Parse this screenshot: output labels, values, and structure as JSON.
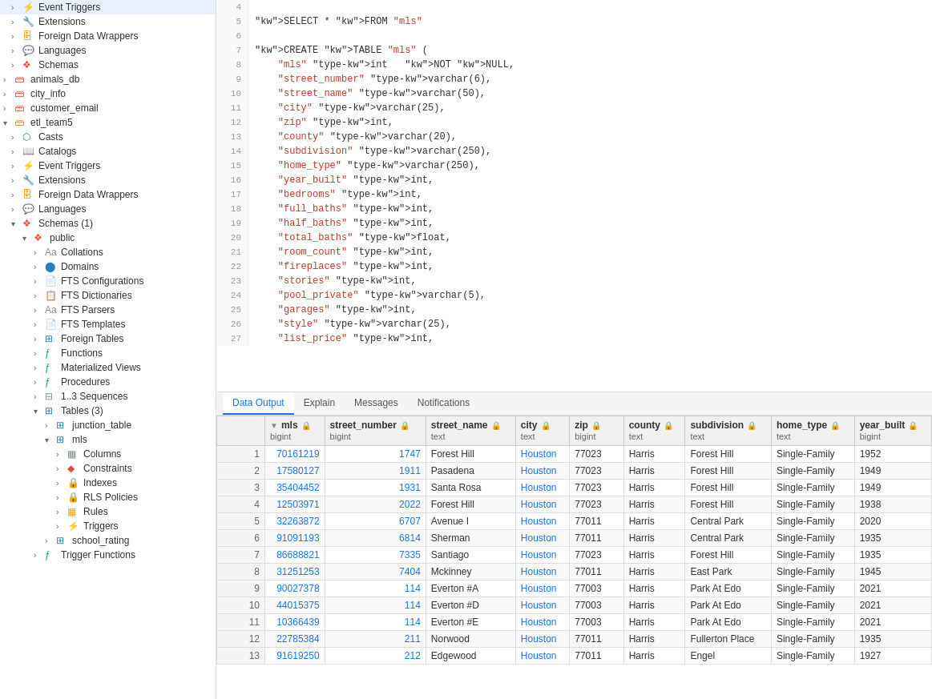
{
  "sidebar": {
    "items": [
      {
        "id": "event-triggers-1",
        "label": "Event Triggers",
        "indent": "indent1",
        "arrow": "›",
        "icon": "⚡",
        "icon_class": "icon-orange"
      },
      {
        "id": "extensions-1",
        "label": "Extensions",
        "indent": "indent1",
        "arrow": "›",
        "icon": "🔧",
        "icon_class": "icon-blue"
      },
      {
        "id": "foreign-data-wrappers-1",
        "label": "Foreign Data Wrappers",
        "indent": "indent1",
        "arrow": "›",
        "icon": "🗄",
        "icon_class": "icon-yellow"
      },
      {
        "id": "languages-1",
        "label": "Languages",
        "indent": "indent1",
        "arrow": "›",
        "icon": "💬",
        "icon_class": "icon-teal"
      },
      {
        "id": "schemas-1",
        "label": "Schemas",
        "indent": "indent1",
        "arrow": "›",
        "icon": "❖",
        "icon_class": "icon-red"
      },
      {
        "id": "animals-db",
        "label": "animals_db",
        "indent": "",
        "arrow": "›",
        "icon": "🗃",
        "icon_class": "icon-red"
      },
      {
        "id": "city-info",
        "label": "city_info",
        "indent": "",
        "arrow": "›",
        "icon": "🗃",
        "icon_class": "icon-red"
      },
      {
        "id": "customer-email",
        "label": "customer_email",
        "indent": "",
        "arrow": "›",
        "icon": "🗃",
        "icon_class": "icon-red"
      },
      {
        "id": "etl-team5",
        "label": "etl_team5",
        "indent": "",
        "arrow": "▾",
        "icon": "🗃",
        "icon_class": "icon-orange"
      },
      {
        "id": "casts",
        "label": "Casts",
        "indent": "indent1",
        "arrow": "›",
        "icon": "⬡",
        "icon_class": "icon-blue"
      },
      {
        "id": "catalogs",
        "label": "Catalogs",
        "indent": "indent1",
        "arrow": "›",
        "icon": "📖",
        "icon_class": "icon-purple"
      },
      {
        "id": "event-triggers-2",
        "label": "Event Triggers",
        "indent": "indent1",
        "arrow": "›",
        "icon": "⚡",
        "icon_class": "icon-orange"
      },
      {
        "id": "extensions-2",
        "label": "Extensions",
        "indent": "indent1",
        "arrow": "›",
        "icon": "🔧",
        "icon_class": "icon-blue"
      },
      {
        "id": "foreign-data-wrappers-2",
        "label": "Foreign Data Wrappers",
        "indent": "indent1",
        "arrow": "›",
        "icon": "🗄",
        "icon_class": "icon-yellow"
      },
      {
        "id": "languages-2",
        "label": "Languages",
        "indent": "indent1",
        "arrow": "›",
        "icon": "💬",
        "icon_class": "icon-teal"
      },
      {
        "id": "schemas-2",
        "label": "Schemas (1)",
        "indent": "indent1",
        "arrow": "▾",
        "icon": "❖",
        "icon_class": "icon-red"
      },
      {
        "id": "public",
        "label": "public",
        "indent": "indent2",
        "arrow": "▾",
        "icon": "❖",
        "icon_class": "icon-red"
      },
      {
        "id": "collations",
        "label": "Collations",
        "indent": "indent3",
        "arrow": "›",
        "icon": "Aa",
        "icon_class": "icon-gray"
      },
      {
        "id": "domains",
        "label": "Domains",
        "indent": "indent3",
        "arrow": "›",
        "icon": "⬤",
        "icon_class": "icon-blue"
      },
      {
        "id": "fts-configs",
        "label": "FTS Configurations",
        "indent": "indent3",
        "arrow": "›",
        "icon": "📄",
        "icon_class": "icon-gray"
      },
      {
        "id": "fts-dicts",
        "label": "FTS Dictionaries",
        "indent": "indent3",
        "arrow": "›",
        "icon": "📋",
        "icon_class": "icon-gray"
      },
      {
        "id": "fts-parsers",
        "label": "FTS Parsers",
        "indent": "indent3",
        "arrow": "›",
        "icon": "Aa",
        "icon_class": "icon-gray"
      },
      {
        "id": "fts-templates",
        "label": "FTS Templates",
        "indent": "indent3",
        "arrow": "›",
        "icon": "📄",
        "icon_class": "icon-gray"
      },
      {
        "id": "foreign-tables",
        "label": "Foreign Tables",
        "indent": "indent3",
        "arrow": "›",
        "icon": "⊞",
        "icon_class": "icon-blue"
      },
      {
        "id": "functions",
        "label": "Functions",
        "indent": "indent3",
        "arrow": "›",
        "icon": "ƒ",
        "icon_class": "icon-teal"
      },
      {
        "id": "materialized-views",
        "label": "Materialized Views",
        "indent": "indent3",
        "arrow": "›",
        "icon": "ƒ",
        "icon_class": "icon-teal"
      },
      {
        "id": "procedures",
        "label": "Procedures",
        "indent": "indent3",
        "arrow": "›",
        "icon": "ƒ",
        "icon_class": "icon-teal"
      },
      {
        "id": "sequences",
        "label": "1..3 Sequences",
        "indent": "indent3",
        "arrow": "›",
        "icon": "⊟",
        "icon_class": "icon-gray"
      },
      {
        "id": "tables",
        "label": "Tables (3)",
        "indent": "indent3",
        "arrow": "▾",
        "icon": "⊞",
        "icon_class": "icon-blue"
      },
      {
        "id": "junction-table",
        "label": "junction_table",
        "indent": "indent4",
        "arrow": "›",
        "icon": "⊞",
        "icon_class": "icon-blue"
      },
      {
        "id": "mls",
        "label": "mls",
        "indent": "indent4",
        "arrow": "▾",
        "icon": "⊞",
        "icon_class": "icon-blue"
      },
      {
        "id": "columns",
        "label": "Columns",
        "indent": "indent5",
        "arrow": "›",
        "icon": "▦",
        "icon_class": "icon-gray"
      },
      {
        "id": "constraints",
        "label": "Constraints",
        "indent": "indent5",
        "arrow": "›",
        "icon": "◆",
        "icon_class": "icon-red"
      },
      {
        "id": "indexes",
        "label": "Indexes",
        "indent": "indent5",
        "arrow": "›",
        "icon": "🔒",
        "icon_class": "icon-yellow"
      },
      {
        "id": "rls-policies",
        "label": "RLS Policies",
        "indent": "indent5",
        "arrow": "›",
        "icon": "🔒",
        "icon_class": "icon-green"
      },
      {
        "id": "rules",
        "label": "Rules",
        "indent": "indent5",
        "arrow": "›",
        "icon": "▦",
        "icon_class": "icon-yellow"
      },
      {
        "id": "triggers",
        "label": "Triggers",
        "indent": "indent5",
        "arrow": "›",
        "icon": "⚡",
        "icon_class": "icon-blue"
      },
      {
        "id": "school-rating",
        "label": "school_rating",
        "indent": "indent4",
        "arrow": "›",
        "icon": "⊞",
        "icon_class": "icon-blue"
      },
      {
        "id": "trigger-functions",
        "label": "Trigger Functions",
        "indent": "indent3",
        "arrow": "›",
        "icon": "ƒ",
        "icon_class": "icon-teal"
      }
    ]
  },
  "editor": {
    "lines": [
      {
        "num": 4,
        "content": ""
      },
      {
        "num": 5,
        "content": "SELECT * FROM \"mls\""
      },
      {
        "num": 6,
        "content": ""
      },
      {
        "num": 7,
        "content": "CREATE TABLE \"mls\" ("
      },
      {
        "num": 8,
        "content": "    \"mls\" int   NOT NULL,"
      },
      {
        "num": 9,
        "content": "    \"street_number\" varchar(6),"
      },
      {
        "num": 10,
        "content": "    \"street_name\" varchar(50),"
      },
      {
        "num": 11,
        "content": "    \"city\" varchar(25),"
      },
      {
        "num": 12,
        "content": "    \"zip\" int,"
      },
      {
        "num": 13,
        "content": "    \"county\" varchar(20),"
      },
      {
        "num": 14,
        "content": "    \"subdivision\" varchar(250),"
      },
      {
        "num": 15,
        "content": "    \"home_type\" varchar(250),"
      },
      {
        "num": 16,
        "content": "    \"year_built\" int,"
      },
      {
        "num": 17,
        "content": "    \"bedrooms\" int,"
      },
      {
        "num": 18,
        "content": "    \"full_baths\" int,"
      },
      {
        "num": 19,
        "content": "    \"half_baths\" int,"
      },
      {
        "num": 20,
        "content": "    \"total_baths\" float,"
      },
      {
        "num": 21,
        "content": "    \"room_count\" int,"
      },
      {
        "num": 22,
        "content": "    \"fireplaces\" int,"
      },
      {
        "num": 23,
        "content": "    \"stories\" int,"
      },
      {
        "num": 24,
        "content": "    \"pool_private\" varchar(5),"
      },
      {
        "num": 25,
        "content": "    \"garages\" int,"
      },
      {
        "num": 26,
        "content": "    \"style\" varchar(25),"
      },
      {
        "num": 27,
        "content": "    \"list_price\" int,"
      }
    ]
  },
  "tabs": [
    {
      "id": "data-output",
      "label": "Data Output",
      "active": true
    },
    {
      "id": "explain",
      "label": "Explain",
      "active": false
    },
    {
      "id": "messages",
      "label": "Messages",
      "active": false
    },
    {
      "id": "notifications",
      "label": "Notifications",
      "active": false
    }
  ],
  "table": {
    "columns": [
      {
        "name": "mls",
        "type": "bigint",
        "sort": true,
        "lock": true
      },
      {
        "name": "street_number",
        "type": "bigint",
        "sort": false,
        "lock": true
      },
      {
        "name": "street_name",
        "type": "text",
        "sort": false,
        "lock": true
      },
      {
        "name": "city",
        "type": "text",
        "sort": false,
        "lock": true
      },
      {
        "name": "zip",
        "type": "bigint",
        "sort": false,
        "lock": true
      },
      {
        "name": "county",
        "type": "text",
        "sort": false,
        "lock": true
      },
      {
        "name": "subdivision",
        "type": "text",
        "sort": false,
        "lock": true
      },
      {
        "name": "home_type",
        "type": "text",
        "sort": false,
        "lock": true
      },
      {
        "name": "year_built",
        "type": "bigint",
        "sort": false,
        "lock": true
      }
    ],
    "rows": [
      {
        "rownum": 1,
        "mls": "70161219",
        "street_number": "1747",
        "street_name": "Forest Hill",
        "city": "Houston",
        "zip": "77023",
        "county": "Harris",
        "subdivision": "Forest Hill",
        "home_type": "Single-Family",
        "year_built": "1952"
      },
      {
        "rownum": 2,
        "mls": "17580127",
        "street_number": "1911",
        "street_name": "Pasadena",
        "city": "Houston",
        "zip": "77023",
        "county": "Harris",
        "subdivision": "Forest Hill",
        "home_type": "Single-Family",
        "year_built": "1949"
      },
      {
        "rownum": 3,
        "mls": "35404452",
        "street_number": "1931",
        "street_name": "Santa Rosa",
        "city": "Houston",
        "zip": "77023",
        "county": "Harris",
        "subdivision": "Forest Hill",
        "home_type": "Single-Family",
        "year_built": "1949"
      },
      {
        "rownum": 4,
        "mls": "12503971",
        "street_number": "2022",
        "street_name": "Forest Hill",
        "city": "Houston",
        "zip": "77023",
        "county": "Harris",
        "subdivision": "Forest Hill",
        "home_type": "Single-Family",
        "year_built": "1938"
      },
      {
        "rownum": 5,
        "mls": "32263872",
        "street_number": "6707",
        "street_name": "Avenue I",
        "city": "Houston",
        "zip": "77011",
        "county": "Harris",
        "subdivision": "Central Park",
        "home_type": "Single-Family",
        "year_built": "2020"
      },
      {
        "rownum": 6,
        "mls": "91091193",
        "street_number": "6814",
        "street_name": "Sherman",
        "city": "Houston",
        "zip": "77011",
        "county": "Harris",
        "subdivision": "Central Park",
        "home_type": "Single-Family",
        "year_built": "1935"
      },
      {
        "rownum": 7,
        "mls": "86688821",
        "street_number": "7335",
        "street_name": "Santiago",
        "city": "Houston",
        "zip": "77023",
        "county": "Harris",
        "subdivision": "Forest Hill",
        "home_type": "Single-Family",
        "year_built": "1935"
      },
      {
        "rownum": 8,
        "mls": "31251253",
        "street_number": "7404",
        "street_name": "Mckinney",
        "city": "Houston",
        "zip": "77011",
        "county": "Harris",
        "subdivision": "East Park",
        "home_type": "Single-Family",
        "year_built": "1945"
      },
      {
        "rownum": 9,
        "mls": "90027378",
        "street_number": "114",
        "street_name": "Everton #A",
        "city": "Houston",
        "zip": "77003",
        "county": "Harris",
        "subdivision": "Park At Edo",
        "home_type": "Single-Family",
        "year_built": "2021"
      },
      {
        "rownum": 10,
        "mls": "44015375",
        "street_number": "114",
        "street_name": "Everton #D",
        "city": "Houston",
        "zip": "77003",
        "county": "Harris",
        "subdivision": "Park At Edo",
        "home_type": "Single-Family",
        "year_built": "2021"
      },
      {
        "rownum": 11,
        "mls": "10366439",
        "street_number": "114",
        "street_name": "Everton #E",
        "city": "Houston",
        "zip": "77003",
        "county": "Harris",
        "subdivision": "Park At Edo",
        "home_type": "Single-Family",
        "year_built": "2021"
      },
      {
        "rownum": 12,
        "mls": "22785384",
        "street_number": "211",
        "street_name": "Norwood",
        "city": "Houston",
        "zip": "77011",
        "county": "Harris",
        "subdivision": "Fullerton Place",
        "home_type": "Single-Family",
        "year_built": "1935"
      },
      {
        "rownum": 13,
        "mls": "91619250",
        "street_number": "212",
        "street_name": "Edgewood",
        "city": "Houston",
        "zip": "77011",
        "county": "Harris",
        "subdivision": "Engel",
        "home_type": "Single-Family",
        "year_built": "1927"
      }
    ]
  }
}
